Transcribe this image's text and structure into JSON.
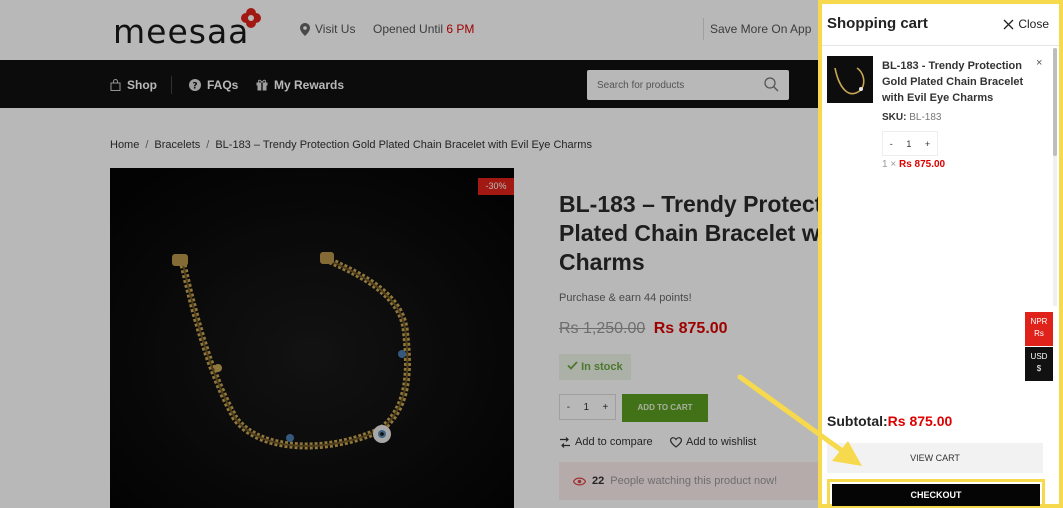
{
  "header": {
    "logo": "meesaa",
    "visit": "Visit Us",
    "opened_prefix": "Opened Until",
    "opened_time": "6 PM",
    "save_more": "Save More On App"
  },
  "nav": {
    "shop": "Shop",
    "faqs": "FAQs",
    "rewards": "My Rewards",
    "search_placeholder": "Search for products"
  },
  "breadcrumb": {
    "home": "Home",
    "category": "Bracelets",
    "current": "BL-183 – Trendy Protection Gold Plated Chain Bracelet with Evil Eye Charms"
  },
  "product": {
    "badge": "-30%",
    "title": "BL-183 – Trendy Protection Gold Plated Chain Bracelet with Evil Eye Charms",
    "points": "Purchase & earn 44 points!",
    "old_price": "Rs 1,250.00",
    "new_price": "Rs 875.00",
    "stock": "In stock",
    "qty_minus": "-",
    "qty": "1",
    "qty_plus": "+",
    "add_to_cart": "ADD TO CART",
    "compare": "Add to compare",
    "wishlist": "Add to wishlist",
    "watching_count": "22",
    "watching_text": "People watching this product now!"
  },
  "cart": {
    "title": "Shopping cart",
    "close": "Close",
    "item": {
      "name": "BL-183 - Trendy Protection Gold Plated Chain Bracelet with Evil Eye Charms",
      "remove": "×",
      "sku_label": "SKU:",
      "sku": "BL-183",
      "qty_minus": "-",
      "qty": "1",
      "qty_plus": "+",
      "line_qty": "1 ×",
      "line_price": "Rs 875.00"
    },
    "currency": {
      "npr_code": "NPR",
      "npr_symbol": "Rs",
      "usd_code": "USD",
      "usd_symbol": "$"
    },
    "subtotal_label": "Subtotal:",
    "subtotal_amount": "Rs 875.00",
    "view_cart": "VIEW CART",
    "checkout": "CHECKOUT"
  },
  "colors": {
    "accent_red": "#e0231a",
    "add_cart_green": "#5c9e21",
    "highlight_yellow": "#f6d94d",
    "nav_black": "#111111"
  },
  "icons": [
    "map-pin-icon",
    "shop-bag-icon",
    "question-icon",
    "gift-icon",
    "search-icon",
    "check-icon",
    "compare-icon",
    "heart-icon",
    "eye-icon",
    "close-icon",
    "arrow-annotation"
  ]
}
